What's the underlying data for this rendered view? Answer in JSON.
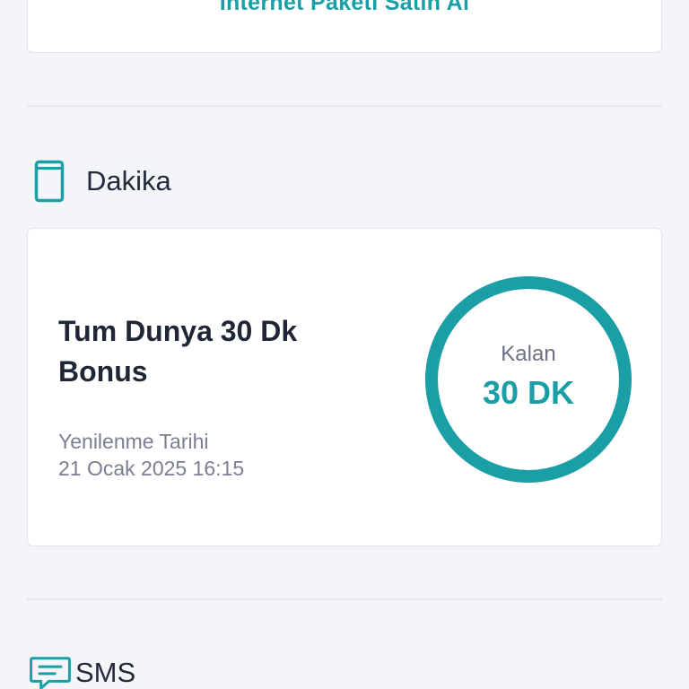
{
  "top_card": {
    "link_label": "Internet Paketi Satin Al"
  },
  "minutes_section": {
    "title": "Dakika",
    "icon": "phone-icon",
    "card": {
      "package_name": "Tum Dunya 30 Dk Bonus",
      "renewal_label": "Yenilenme Tarihi",
      "renewal_date": "21 Ocak 2025 16:15",
      "remaining_label": "Kalan",
      "remaining_value": "30 DK",
      "remaining_fraction": 1.0
    }
  },
  "sms_section": {
    "title": "SMS",
    "icon": "message-icon"
  },
  "colors": {
    "accent": "#1a9fa6",
    "background": "#f4f5f8",
    "card": "#ffffff",
    "text_dark": "#1f2636",
    "text_muted": "#7b8091"
  }
}
